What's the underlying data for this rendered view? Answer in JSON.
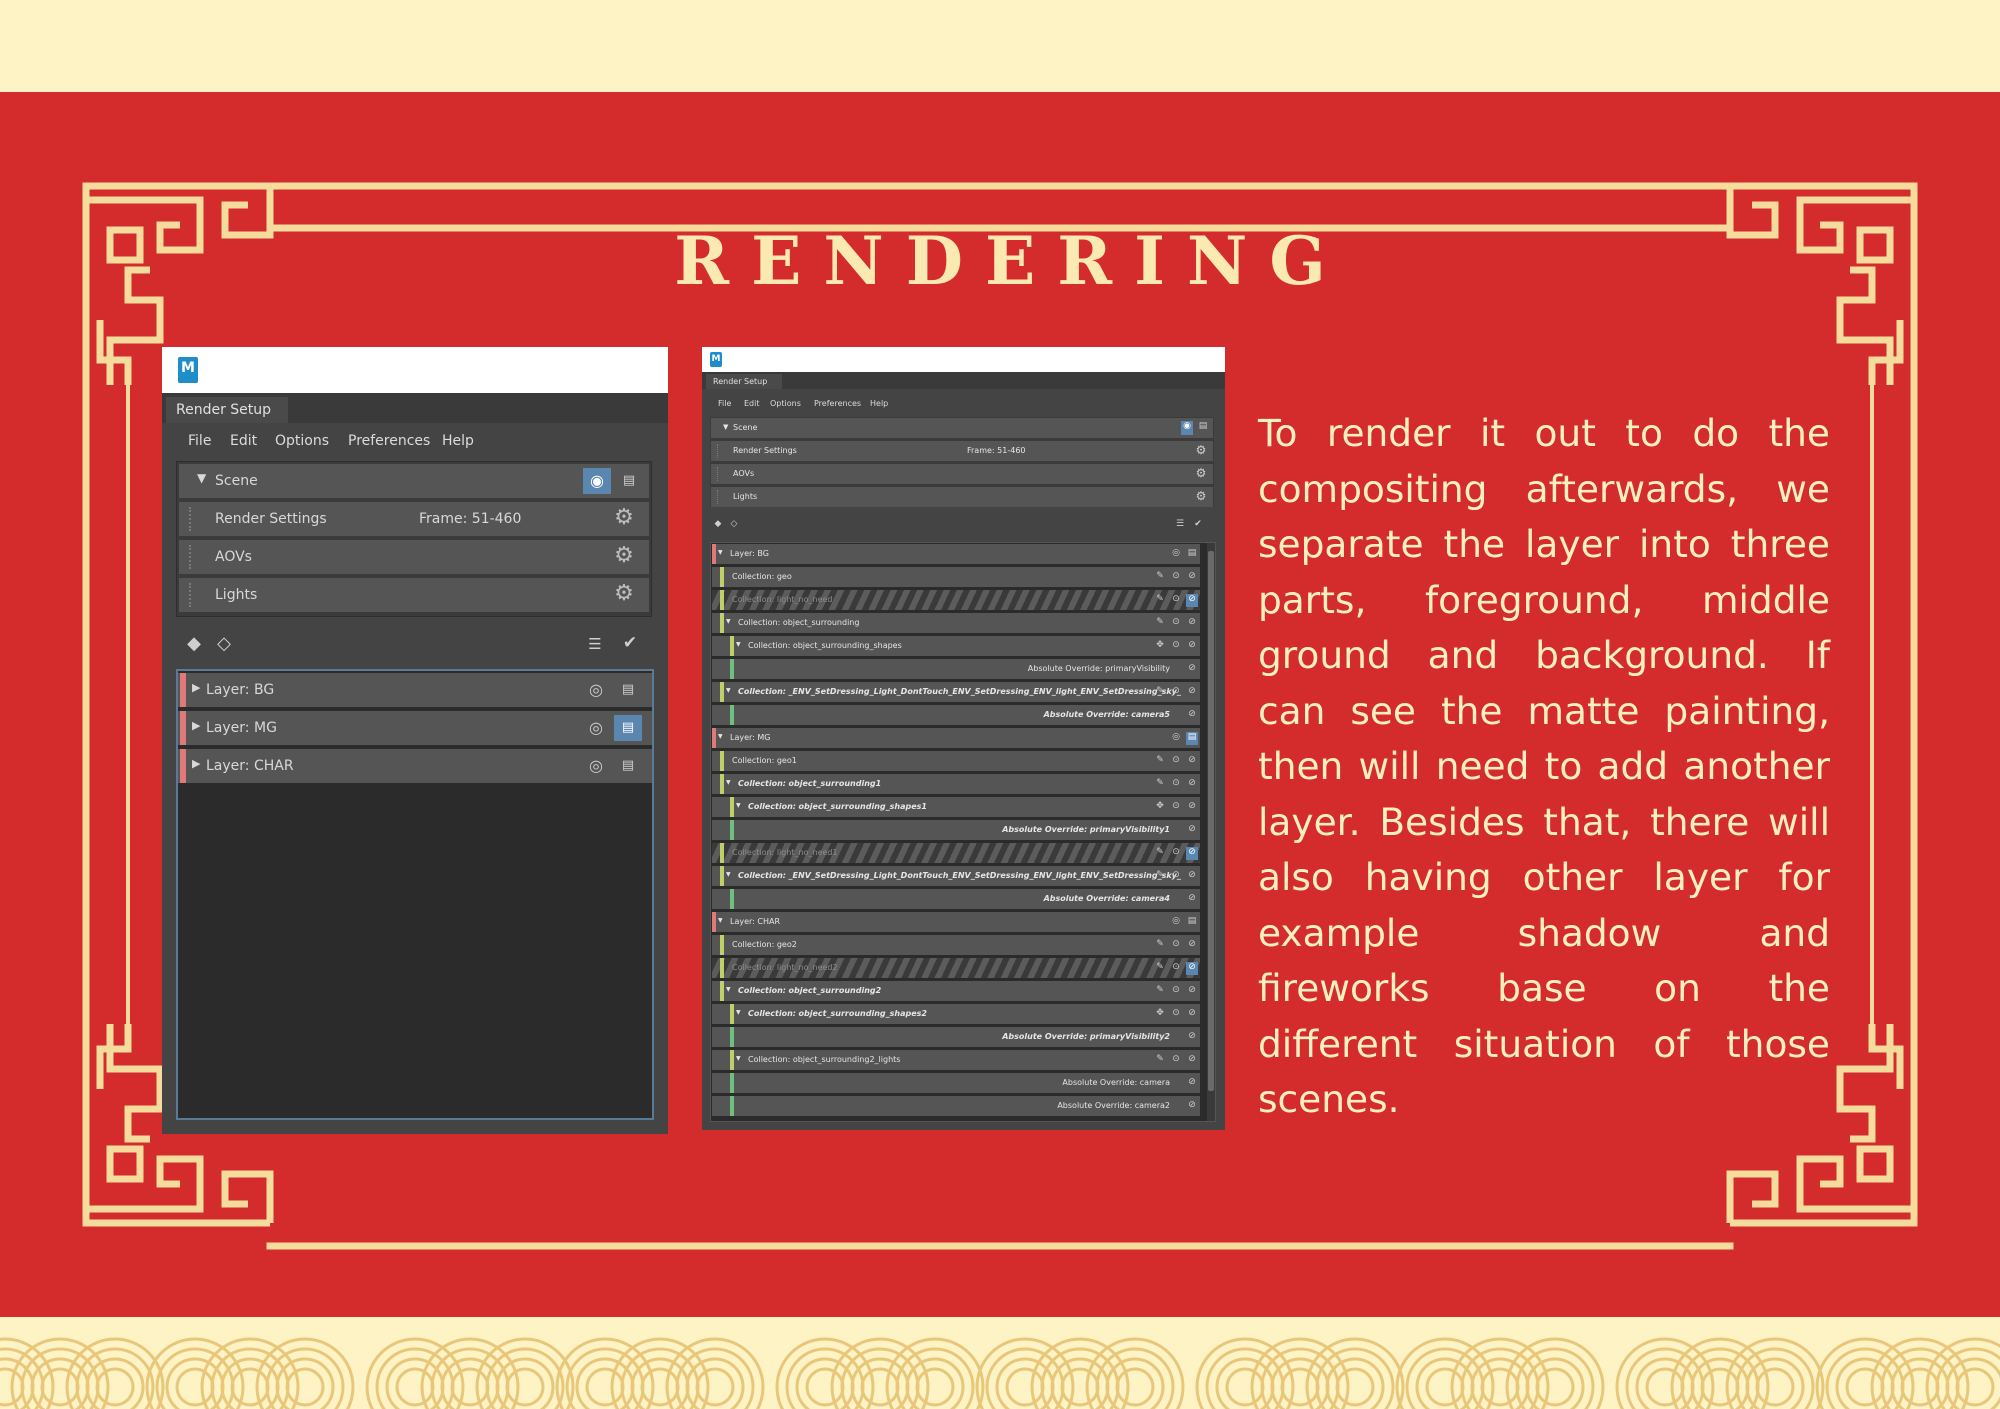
{
  "slide": {
    "title": "RENDERING",
    "body": "To render it out to do the compositing afterwards, we separate the layer into three parts, foreground, middle ground and background. If can see the matte painting, then will need to add another layer. Besides that, there will also having other layer for example shadow and fireworks base on the different situation of those scenes.",
    "colors": {
      "background_red": "#d42b2d",
      "cream": "#fdf3c4",
      "ornament": "#f5dc9c"
    }
  },
  "left_window": {
    "app_icon": "maya-icon",
    "logo_letter": "M",
    "tab": "Render Setup",
    "menu": [
      "File",
      "Edit",
      "Options",
      "Preferences",
      "Help"
    ],
    "scene": {
      "label": "Scene",
      "rows": [
        {
          "label": "Render Settings",
          "value": "Frame: 51-460"
        },
        {
          "label": "AOVs",
          "value": ""
        },
        {
          "label": "Lights",
          "value": ""
        }
      ]
    },
    "layers": [
      {
        "prefix": "Layer:",
        "name": "BG",
        "render_active": false
      },
      {
        "prefix": "Layer:",
        "name": "MG",
        "render_active": true
      },
      {
        "prefix": "Layer:",
        "name": "CHAR",
        "render_active": false
      }
    ]
  },
  "right_window": {
    "logo_letter": "M",
    "tab": "Render Setup",
    "menu": [
      "File",
      "Edit",
      "Options",
      "Preferences",
      "Help"
    ],
    "scene": {
      "label": "Scene",
      "rows": [
        {
          "label": "Render Settings",
          "value": "Frame: 51-460"
        },
        {
          "label": "AOVs",
          "value": ""
        },
        {
          "label": "Lights",
          "value": ""
        }
      ]
    },
    "rows": [
      {
        "kind": "layer",
        "prefix": "Layer:",
        "name": "BG"
      },
      {
        "kind": "collection",
        "indent": 0,
        "prefix": "Collection:",
        "name": "geo",
        "style": "plain"
      },
      {
        "kind": "collection",
        "indent": 0,
        "prefix": "Collection:",
        "name": "light_no_need",
        "style": "disabled"
      },
      {
        "kind": "collection",
        "indent": 0,
        "prefix": "Collection:",
        "name": "object_surrounding",
        "style": "plain",
        "expanded": true
      },
      {
        "kind": "collection",
        "indent": 1,
        "prefix": "Collection:",
        "name": "object_surrounding_shapes",
        "style": "plain",
        "expanded": true
      },
      {
        "kind": "override",
        "prefix": "Absolute Override:",
        "name": "primaryVisibility",
        "style": "plain"
      },
      {
        "kind": "collection",
        "indent": 0,
        "prefix": "Collection:",
        "name": "_ENV_SetDressing_Light_DontTouch_ENV_SetDressing_ENV_light_ENV_SetDressing_sky_",
        "style": "bold",
        "expanded": true
      },
      {
        "kind": "override",
        "prefix": "Absolute Override:",
        "name": "camera5",
        "style": "bold"
      },
      {
        "kind": "layer",
        "prefix": "Layer:",
        "name": "MG"
      },
      {
        "kind": "collection",
        "indent": 0,
        "prefix": "Collection:",
        "name": "geo1",
        "style": "plain"
      },
      {
        "kind": "collection",
        "indent": 0,
        "prefix": "Collection:",
        "name": "object_surrounding1",
        "style": "bold",
        "expanded": true
      },
      {
        "kind": "collection",
        "indent": 1,
        "prefix": "Collection:",
        "name": "object_surrounding_shapes1",
        "style": "bold",
        "expanded": true
      },
      {
        "kind": "override",
        "prefix": "Absolute Override:",
        "name": "primaryVisibility1",
        "style": "bold"
      },
      {
        "kind": "collection",
        "indent": 0,
        "prefix": "Collection:",
        "name": "light_no_need1",
        "style": "disabled"
      },
      {
        "kind": "collection",
        "indent": 0,
        "prefix": "Collection:",
        "name": "_ENV_SetDressing_Light_DontTouch_ENV_SetDressing_ENV_light_ENV_SetDressing_sky_",
        "style": "bold",
        "expanded": true
      },
      {
        "kind": "override",
        "prefix": "Absolute Override:",
        "name": "camera4",
        "style": "bold"
      },
      {
        "kind": "layer",
        "prefix": "Layer:",
        "name": "CHAR"
      },
      {
        "kind": "collection",
        "indent": 0,
        "prefix": "Collection:",
        "name": "geo2",
        "style": "plain"
      },
      {
        "kind": "collection",
        "indent": 0,
        "prefix": "Collection:",
        "name": "light_no_need2",
        "style": "disabled"
      },
      {
        "kind": "collection",
        "indent": 0,
        "prefix": "Collection:",
        "name": "object_surrounding2",
        "style": "bold",
        "expanded": true
      },
      {
        "kind": "collection",
        "indent": 1,
        "prefix": "Collection:",
        "name": "object_surrounding_shapes2",
        "style": "bold",
        "expanded": true
      },
      {
        "kind": "override",
        "prefix": "Absolute Override:",
        "name": "primaryVisibility2",
        "style": "bold"
      },
      {
        "kind": "collection",
        "indent": 1,
        "prefix": "Collection:",
        "name": "object_surrounding2_lights",
        "style": "plain",
        "expanded": true
      },
      {
        "kind": "override",
        "prefix": "Absolute Override:",
        "name": "camera",
        "style": "plain"
      },
      {
        "kind": "override",
        "prefix": "Absolute Override:",
        "name": "camera2",
        "style": "plain"
      }
    ]
  }
}
